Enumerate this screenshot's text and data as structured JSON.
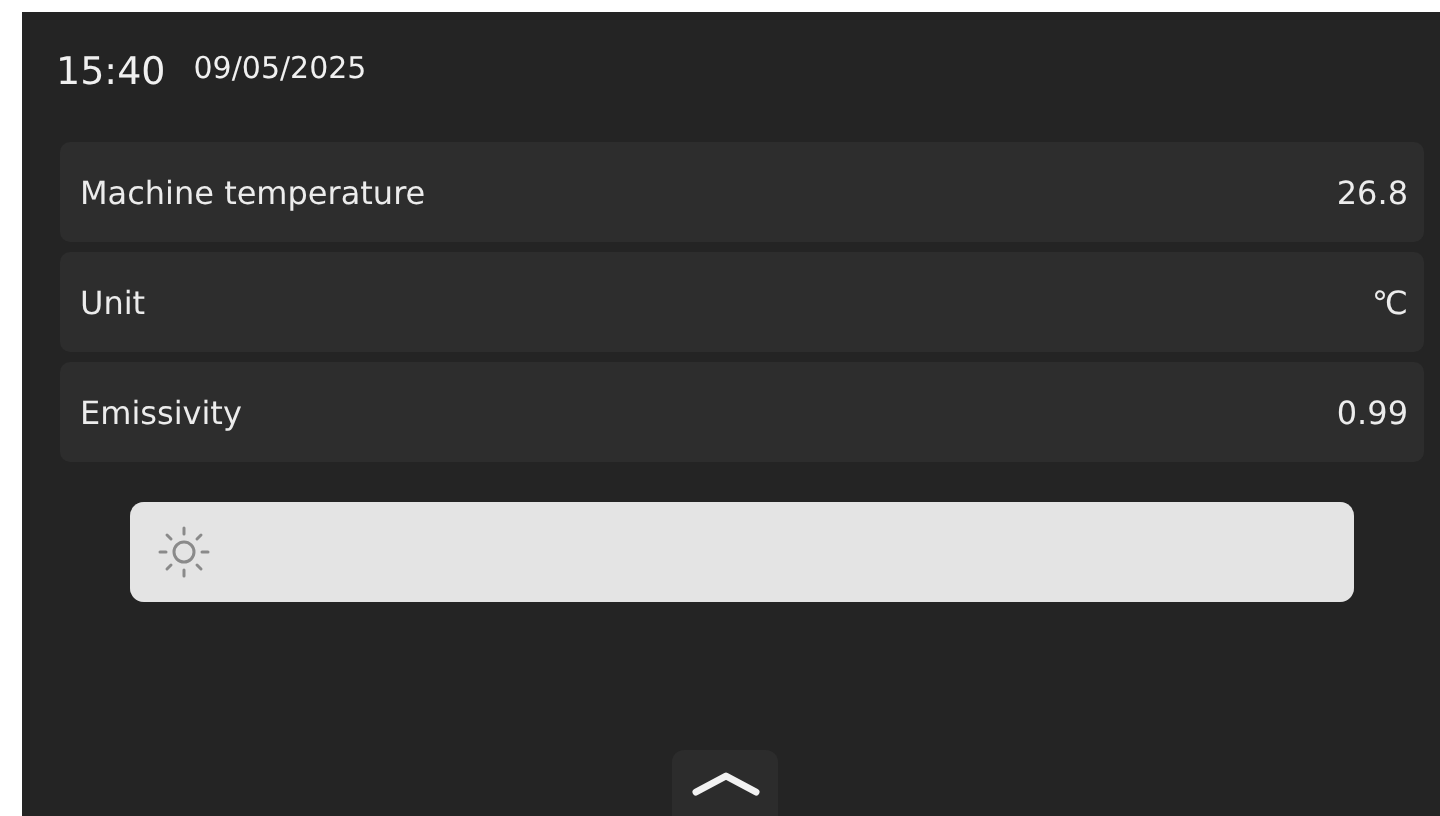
{
  "header": {
    "time": "15:40",
    "date": "09/05/2025"
  },
  "settings": [
    {
      "label": "Machine temperature",
      "value": "26.8"
    },
    {
      "label": "Unit",
      "value": "℃"
    },
    {
      "label": "Emissivity",
      "value": "0.99"
    }
  ],
  "brightness": {
    "level": 1
  }
}
